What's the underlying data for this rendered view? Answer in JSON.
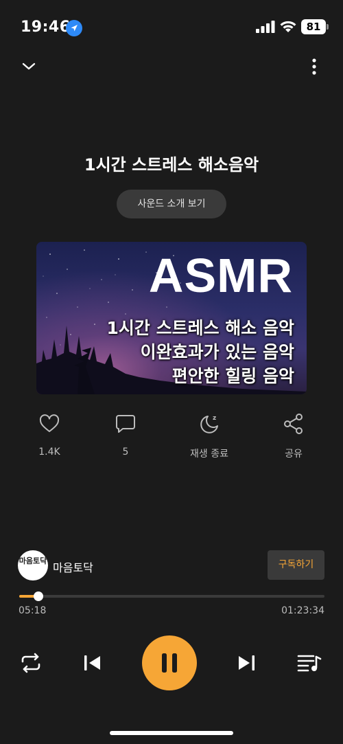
{
  "status_bar": {
    "time": "19:46",
    "battery": "81"
  },
  "track": {
    "title": "1시간 스트레스 해소음악"
  },
  "intro_button": {
    "label": "사운드 소개 보기"
  },
  "thumbnail": {
    "big_text": "ASMR",
    "line1": "1시간 스트레스 해소 음악",
    "line2": "이완효과가 있는 음악",
    "line3": "편안한 힐링 음악"
  },
  "actions": {
    "like": {
      "icon": "heart-icon",
      "label": "1.4K"
    },
    "comment": {
      "icon": "comment-icon",
      "label": "5"
    },
    "sleep_timer": {
      "icon": "moon-icon",
      "label": "재생 종료"
    },
    "share": {
      "icon": "share-icon",
      "label": "공유"
    }
  },
  "channel": {
    "avatar_text": "마음토닥",
    "name": "마음토닥",
    "subscribe_label": "구독하기"
  },
  "progress": {
    "elapsed": "05:18",
    "total": "01:23:34",
    "fraction": 0.0634
  },
  "colors": {
    "accent": "#f6a636",
    "background": "#1b1b1b",
    "button_bg": "#3a3a3a"
  }
}
